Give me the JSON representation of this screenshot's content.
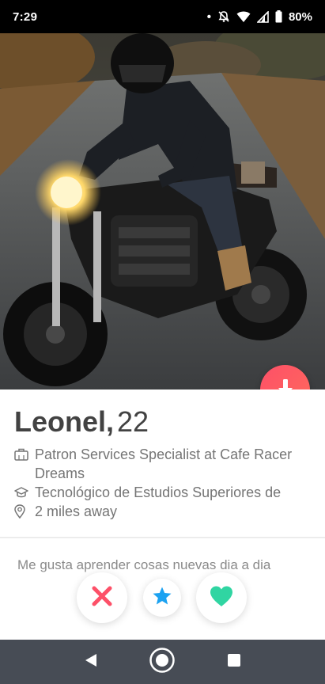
{
  "status_bar": {
    "time": "7:29",
    "dot": "•",
    "icons": [
      "notifications-off-icon",
      "wifi-icon",
      "cell-signal-icon",
      "battery-icon"
    ],
    "battery": "80%"
  },
  "profile": {
    "photo": "profile-photo-motorcycle-rider",
    "name": "Leonel,",
    "age": "22",
    "job": "Patron Services Specialist at Cafe Racer Dreams",
    "school": "Tecnológico de Estudios Superiores de",
    "distance": "2 miles away",
    "bio": "Me gusta aprender cosas nuevas dia a dia"
  },
  "actions": {
    "info_icon": "arrow-down-icon",
    "nope_icon": "close-icon",
    "superlike_icon": "star-icon",
    "like_icon": "heart-icon"
  },
  "colors": {
    "brand": "#fd5068",
    "nope": "#fd5068",
    "superlike": "#1ca2f1",
    "like": "#30d5a2",
    "nav_bar": "#474c55"
  },
  "nav_bar": {
    "icons": [
      "back-icon",
      "home-icon",
      "recents-icon"
    ]
  }
}
